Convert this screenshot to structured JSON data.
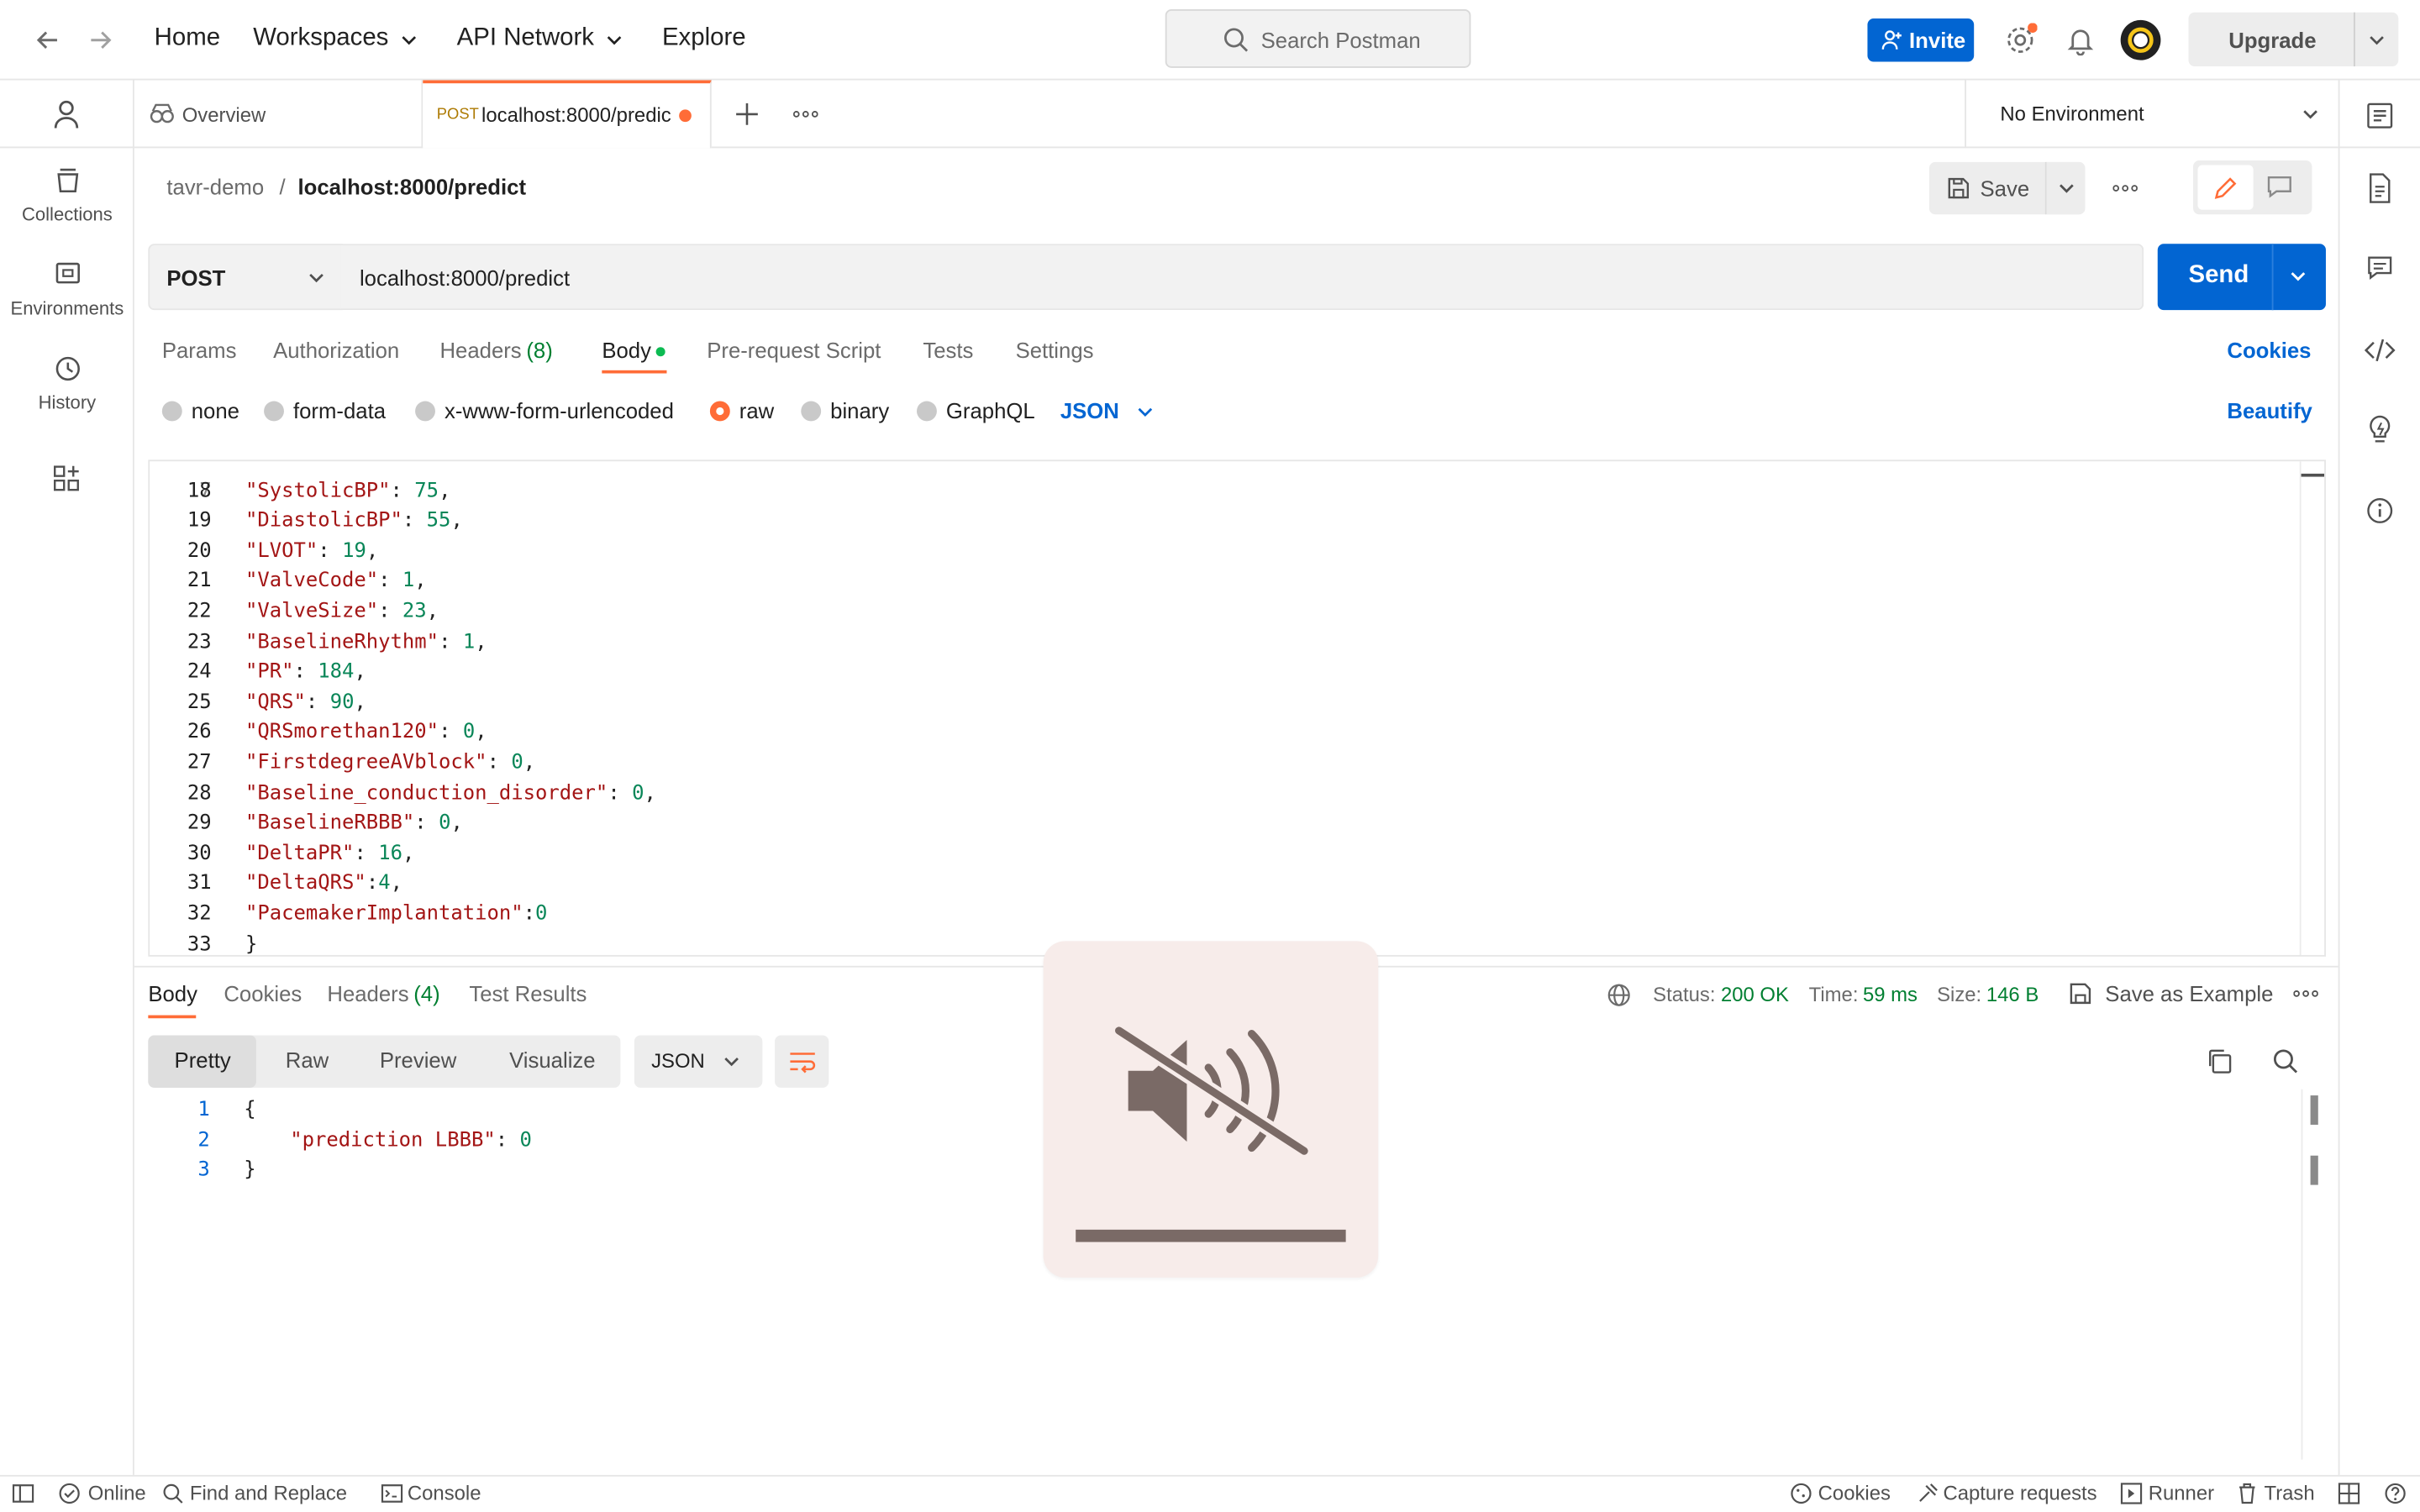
{
  "topnav": {
    "home": "Home",
    "workspaces": "Workspaces",
    "api_network": "API Network",
    "explore": "Explore",
    "search_placeholder": "Search Postman",
    "invite": "Invite",
    "upgrade": "Upgrade"
  },
  "sidebar": {
    "items": [
      {
        "label": "Collections"
      },
      {
        "label": "Environments"
      },
      {
        "label": "History"
      }
    ]
  },
  "tabs": {
    "overview": "Overview",
    "active_method": "POST",
    "active_title": "localhost:8000/predic",
    "environment": "No Environment"
  },
  "breadcrumb": {
    "collection": "tavr-demo",
    "separator": "/",
    "request": "localhost:8000/predict",
    "save": "Save"
  },
  "request": {
    "method": "POST",
    "url": "localhost:8000/predict",
    "send": "Send",
    "tabs": {
      "params": "Params",
      "authorization": "Authorization",
      "headers": "Headers",
      "headers_count": "(8)",
      "body": "Body",
      "prerequest": "Pre-request Script",
      "tests": "Tests",
      "settings": "Settings",
      "cookies": "Cookies"
    },
    "body_types": {
      "none": "none",
      "form_data": "form-data",
      "urlencoded": "x-www-form-urlencoded",
      "raw": "raw",
      "binary": "binary",
      "graphql": "GraphQL",
      "format": "JSON",
      "beautify": "Beautify"
    }
  },
  "editor": {
    "lines": [
      {
        "n": "18",
        "key": "\"SystolicBP\"",
        "val": "75",
        "sep": ": ",
        "end": ","
      },
      {
        "n": "19",
        "key": "\"DiastolicBP\"",
        "val": "55",
        "sep": ": ",
        "end": ","
      },
      {
        "n": "20",
        "key": "\"LVOT\"",
        "val": "19",
        "sep": ": ",
        "end": ","
      },
      {
        "n": "21",
        "key": "\"ValveCode\"",
        "val": "1",
        "sep": ": ",
        "end": ","
      },
      {
        "n": "22",
        "key": "\"ValveSize\"",
        "val": "23",
        "sep": ": ",
        "end": ","
      },
      {
        "n": "23",
        "key": "\"BaselineRhythm\"",
        "val": "1",
        "sep": ": ",
        "end": ","
      },
      {
        "n": "24",
        "key": "\"PR\"",
        "val": "184",
        "sep": ": ",
        "end": ","
      },
      {
        "n": "25",
        "key": "\"QRS\"",
        "val": "90",
        "sep": ": ",
        "end": ","
      },
      {
        "n": "26",
        "key": "\"QRSmorethan120\"",
        "val": "0",
        "sep": ": ",
        "end": ","
      },
      {
        "n": "27",
        "key": "\"FirstdegreeAVblock\"",
        "val": "0",
        "sep": ": ",
        "end": ","
      },
      {
        "n": "28",
        "key": "\"Baseline_conduction_disorder\"",
        "val": "0",
        "sep": ": ",
        "end": ","
      },
      {
        "n": "29",
        "key": "\"BaselineRBBB\"",
        "val": "0",
        "sep": ": ",
        "end": ","
      },
      {
        "n": "30",
        "key": "\"DeltaPR\"",
        "val": "16",
        "sep": ": ",
        "end": ","
      },
      {
        "n": "31",
        "key": "\"DeltaQRS\"",
        "val": "4",
        "sep": ":",
        "end": ","
      },
      {
        "n": "32",
        "key": "\"PacemakerImplantation\"",
        "val": "0",
        "sep": ":",
        "end": ""
      },
      {
        "n": "33",
        "key": "}",
        "val": "",
        "sep": "",
        "end": ""
      }
    ]
  },
  "response": {
    "tabs": {
      "body": "Body",
      "cookies": "Cookies",
      "headers": "Headers",
      "headers_count": "(4)",
      "test_results": "Test Results"
    },
    "status_label": "Status:",
    "status": "200 OK",
    "time_label": "Time:",
    "time": "59 ms",
    "size_label": "Size:",
    "size": "146 B",
    "save_example": "Save as Example",
    "views": {
      "pretty": "Pretty",
      "raw": "Raw",
      "preview": "Preview",
      "visualize": "Visualize",
      "format": "JSON"
    },
    "lines": [
      {
        "n": "1",
        "text": "{"
      },
      {
        "n": "2",
        "key": "\"prediction LBBB\"",
        "val": "0"
      },
      {
        "n": "3",
        "text": "}"
      }
    ]
  },
  "statusbar": {
    "online": "Online",
    "find_replace": "Find and Replace",
    "console": "Console",
    "cookies": "Cookies",
    "capture": "Capture requests",
    "runner": "Runner",
    "trash": "Trash"
  },
  "colors": {
    "accent": "#0265d2",
    "orange": "#ff6c37",
    "status_green": "#007f31",
    "key_red": "#a31515",
    "num_green": "#098658"
  }
}
